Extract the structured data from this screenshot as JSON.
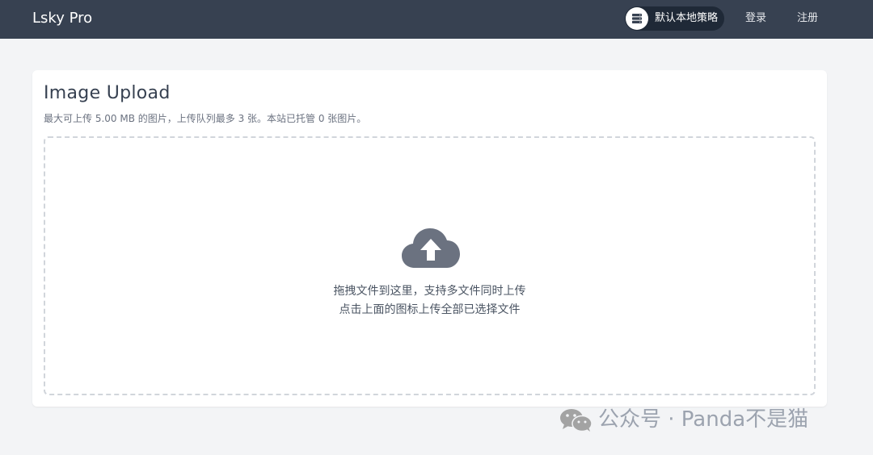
{
  "navbar": {
    "brand": "Lsky Pro",
    "strategy_label": "默认本地策略",
    "login_label": "登录",
    "register_label": "注册"
  },
  "upload": {
    "title": "Image Upload",
    "subtitle": "最大可上传 5.00 MB 的图片，上传队列最多 3 张。本站已托管 0 张图片。",
    "drop_line1": "拖拽文件到这里，支持多文件同时上传",
    "drop_line2": "点击上面的图标上传全部已选择文件"
  },
  "watermark": {
    "text": "公众号 · Panda不是猫"
  },
  "colors": {
    "navbar_bg": "#374151",
    "page_bg": "#f3f4f6",
    "icon_gray": "#6b7280"
  },
  "icons": {
    "strategy": "server-icon",
    "upload": "cloud-upload-icon",
    "watermark": "wechat-icon"
  }
}
